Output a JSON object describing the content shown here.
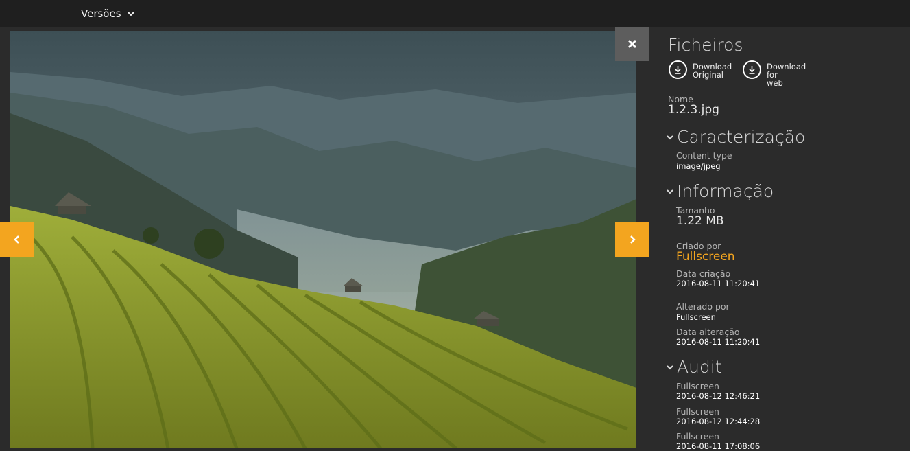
{
  "topbar": {
    "versions_label": "Versões"
  },
  "viewer": {
    "close_icon": "close-icon",
    "prev_icon": "chevron-left-icon",
    "next_icon": "chevron-right-icon"
  },
  "panel": {
    "title": "Ficheiros",
    "downloads": [
      {
        "label_line1": "Download",
        "label_line2": "Original",
        "icon": "download-icon"
      },
      {
        "label_line1": "Download",
        "label_line2": "for",
        "label_line3": "web",
        "icon": "download-icon"
      }
    ],
    "name": {
      "label": "Nome",
      "value": "1.2.3.jpg"
    },
    "characterization": {
      "title": "Caracterização",
      "content_type_label": "Content type",
      "content_type_value": "image/jpeg"
    },
    "information": {
      "title": "Informação",
      "size_label": "Tamanho",
      "size_value": "1.22 MB",
      "created_by_label": "Criado por",
      "created_by_value": "Fullscreen",
      "created_date_label": "Data criação",
      "created_date_value": "2016-08-11 11:20:41",
      "modified_by_label": "Alterado por",
      "modified_by_value": "Fullscreen",
      "modified_date_label": "Data alteração",
      "modified_date_value": "2016-08-11 11:20:41"
    },
    "audit": {
      "title": "Audit",
      "entries": [
        {
          "user": "Fullscreen",
          "date": "2016-08-12 12:46:21"
        },
        {
          "user": "Fullscreen",
          "date": "2016-08-12 12:44:28"
        },
        {
          "user": "Fullscreen",
          "date": "2016-08-11 17:08:06"
        }
      ]
    }
  },
  "colors": {
    "accent": "#f3a51f",
    "panel_bg": "#2b2b2b",
    "topbar_bg": "#1f1f1f"
  }
}
